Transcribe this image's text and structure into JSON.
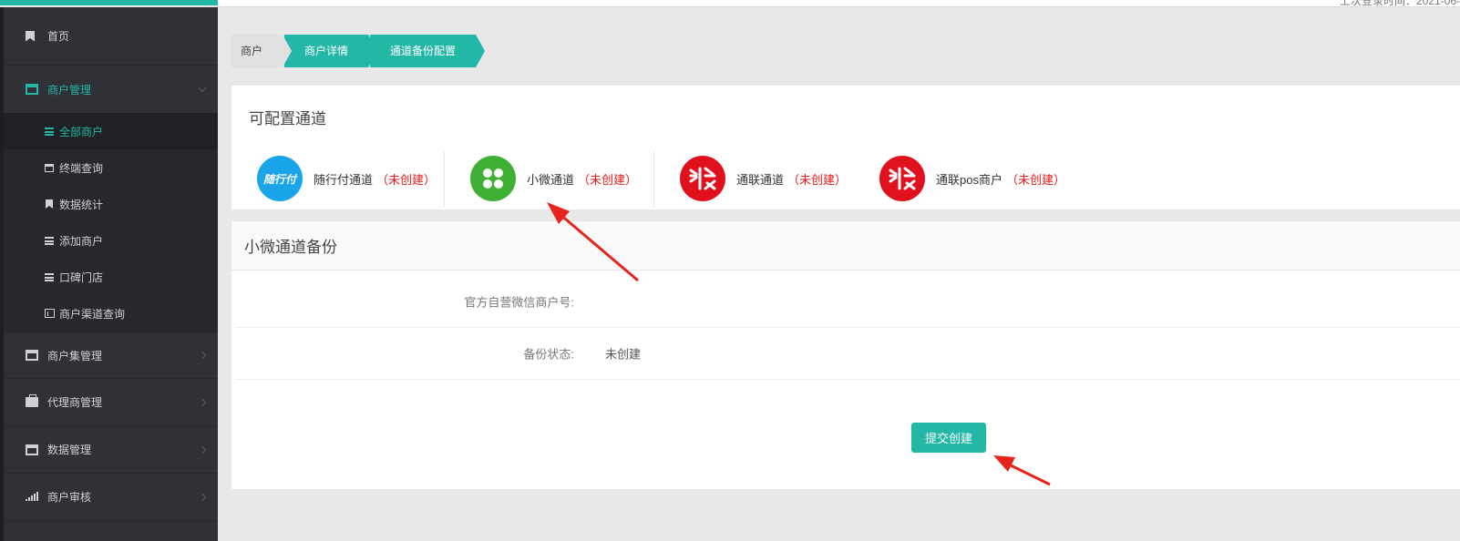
{
  "header": {
    "login_time": "上次登录时间：2021-06-"
  },
  "sidebar": {
    "items": [
      {
        "label": "首页"
      },
      {
        "label": "商户管理"
      },
      {
        "label": "商户集管理"
      },
      {
        "label": "代理商管理"
      },
      {
        "label": "数据管理"
      },
      {
        "label": "商户审核"
      }
    ],
    "sub_items": [
      {
        "label": "全部商户"
      },
      {
        "label": "终端查询"
      },
      {
        "label": "数据统计"
      },
      {
        "label": "添加商户"
      },
      {
        "label": "口碑门店"
      },
      {
        "label": "商户渠道查询"
      }
    ]
  },
  "breadcrumb": [
    "商户",
    "商户详情",
    "通道备份配置"
  ],
  "channels_panel": {
    "title": "可配置通道",
    "channels": [
      {
        "name": "随行付通道",
        "status": "（未创建）",
        "logo_text": "随行付",
        "color": "#1aa5ea"
      },
      {
        "name": "小微通道",
        "status": "（未创建）",
        "color": "#3eb035"
      },
      {
        "name": "通联通道",
        "status": "（未创建）",
        "color": "#e0101d"
      },
      {
        "name": "通联pos商户",
        "status": "（未创建）",
        "color": "#e0101d"
      }
    ]
  },
  "backup_panel": {
    "title": "小微通道备份",
    "rows": [
      {
        "label": "官方自营微信商户号:",
        "value": ""
      },
      {
        "label": "备份状态:",
        "value": "未创建"
      }
    ],
    "submit_label": "提交创建"
  },
  "colors": {
    "accent": "#23b7a6",
    "status_red": "#e61b1b",
    "sidebar_bg": "#2f3136"
  }
}
